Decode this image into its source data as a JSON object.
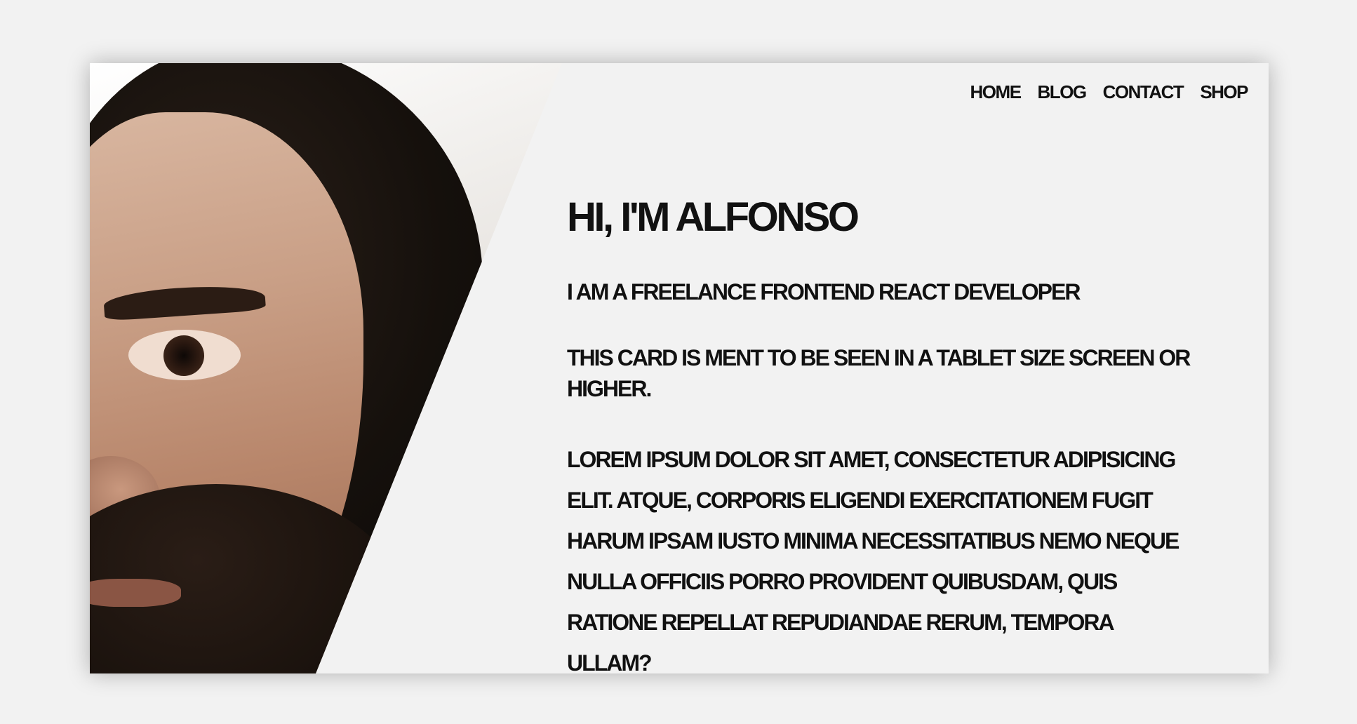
{
  "nav": {
    "items": [
      "HOME",
      "BLOG",
      "CONTACT",
      "SHOP"
    ]
  },
  "hero": {
    "title": "HI, I'M ALFONSO",
    "subtitle": "I AM A FREELANCE FRONTEND REACT DEVELOPER",
    "note": "THIS CARD IS MENT TO BE SEEN IN A TABLET SIZE SCREEN OR HIGHER.",
    "body": "LOREM IPSUM DOLOR SIT AMET, CONSECTETUR ADIPISICING ELIT. ATQUE, CORPORIS ELIGENDI EXERCITATIONEM FUGIT HARUM IPSAM IUSTO MINIMA NECESSITATIBUS NEMO NEQUE NULLA OFFICIIS PORRO PROVIDENT QUIBUSDAM, QUIS RATIONE REPELLAT REPUDIANDAE RERUM, TEMPORA ULLAM?"
  },
  "colors": {
    "background": "#f2f2f2",
    "text": "#111111"
  }
}
